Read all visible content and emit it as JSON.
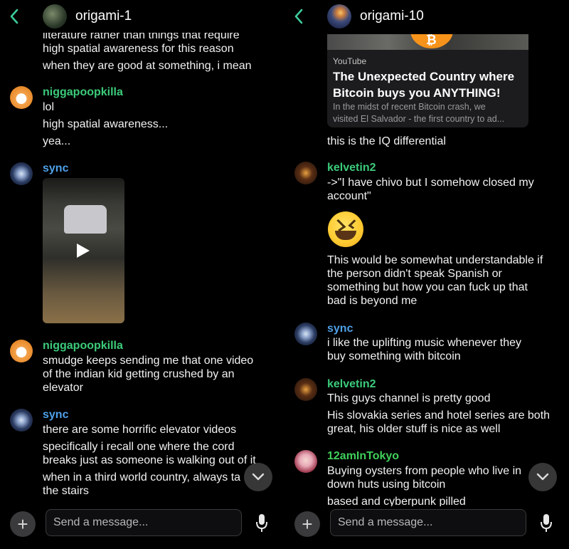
{
  "left": {
    "title": "origami-1",
    "lines": [
      "literature rather than things that require",
      "high spatial awareness for this reason",
      "when they are good at something, i mean"
    ],
    "messages": [
      {
        "author": "niggapoopkilla",
        "lines": [
          "lol",
          "high spatial awareness...",
          "yea..."
        ]
      },
      {
        "author": "sync",
        "lines": []
      },
      {
        "author": "niggapoopkilla",
        "lines": [
          "smudge keeps sending me that one video",
          "of the indian kid getting crushed by an",
          "elevator"
        ]
      },
      {
        "author": "sync",
        "lines": [
          "there are some horrific elevator videos",
          "specifically i recall one where the cord",
          "breaks just as someone is walking out of it",
          "when in a third world country, always ta",
          "the stairs"
        ]
      }
    ],
    "composer_placeholder": "Send a message..."
  },
  "right": {
    "title": "origami-10",
    "embed": {
      "source": "YouTube",
      "title_1": "The Unexpected Country where",
      "title_2": "Bitcoin buys you ANYTHING!",
      "desc_1": "In the midst of recent Bitcoin crash, we",
      "desc_2": "visited El Salvador - the first country to ad..."
    },
    "line_after_embed": "this is the IQ differential",
    "messages": [
      {
        "author": "kelvetin2",
        "lines": [
          "->\"I have chivo but I somehow closed my",
          "account\"",
          "This would be somewhat understandable if",
          "the person didn't speak Spanish or",
          "something but how you can fuck up that",
          "bad is beyond me"
        ]
      },
      {
        "author": "sync",
        "lines": [
          "i like the uplifting music whenever they",
          "buy something with bitcoin"
        ]
      },
      {
        "author": "kelvetin2",
        "lines": [
          "This guys channel is pretty good",
          "His slovakia series and hotel series are both",
          "great, his older stuff is nice as well"
        ]
      },
      {
        "author": "12amInTokyo",
        "lines": [
          "Buying oysters from people who live in",
          "down huts using bitcoin",
          "based and cyberpunk pilled"
        ]
      }
    ],
    "composer_placeholder": "Send a message..."
  },
  "colors": {
    "accent": "#3ccb7a",
    "sync": "#4fa0e8",
    "tokyo": "#3fcf5a",
    "background": "#000000"
  },
  "icons": [
    "back-chevron-icon",
    "play-icon",
    "plus-icon",
    "microphone-icon",
    "chevron-down-icon"
  ]
}
